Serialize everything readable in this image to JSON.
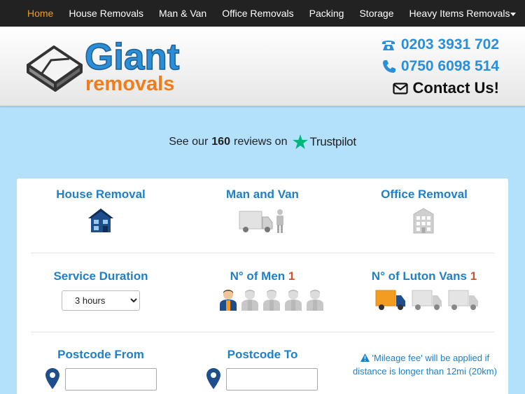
{
  "nav": {
    "items": [
      "Home",
      "House Removals",
      "Man & Van",
      "Office Removals",
      "Packing",
      "Storage",
      "Heavy Items Removals"
    ],
    "active_index": 0
  },
  "header": {
    "logo_line1": "Giant",
    "logo_line2": "removals",
    "phone1": "0203 3931 702",
    "phone2": "0750 6098 514",
    "contact": "Contact Us!"
  },
  "reviews": {
    "prefix": "See our",
    "count": "160",
    "suffix": "reviews on",
    "brand": "Trustpilot"
  },
  "services": {
    "house": "House Removal",
    "man_van": "Man and Van",
    "office": "Office Removal"
  },
  "options": {
    "duration_label": "Service Duration",
    "duration_value": "3 hours",
    "men_label": "N° of Men",
    "men_value": "1",
    "men_max": 5,
    "vans_label": "N° of Luton Vans",
    "vans_value": "1",
    "vans_max": 3
  },
  "postcodes": {
    "from_label": "Postcode From",
    "to_label": "Postcode To",
    "from_value": "",
    "to_value": "",
    "mileage_note": "'Mileage fee' will be applied if distance is longer than 12mi (20km)"
  },
  "colors": {
    "accent_blue": "#1f7fc7",
    "accent_orange": "#ef7d1c",
    "page_bg": "#b3e0fb",
    "nav_bg": "#222222",
    "nav_active": "#f39c1f"
  }
}
